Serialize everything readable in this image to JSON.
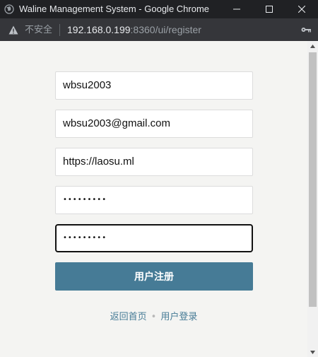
{
  "window": {
    "title": "Waline Management System - Google Chrome"
  },
  "address_bar": {
    "security_label": "不安全",
    "url_host": "192.168.0.199",
    "url_rest": ":8360/ui/register"
  },
  "form": {
    "nickname": "wbsu2003",
    "email": "wbsu2003@gmail.com",
    "website": "https://laosu.ml",
    "password": "•••••••••",
    "password_confirm": "•••••••••",
    "submit_label": "用户注册"
  },
  "footer_links": {
    "home": "返回首页",
    "separator": "•",
    "login": "用户登录"
  },
  "colors": {
    "accent": "#467b96",
    "page_background": "#f4f4f2"
  }
}
